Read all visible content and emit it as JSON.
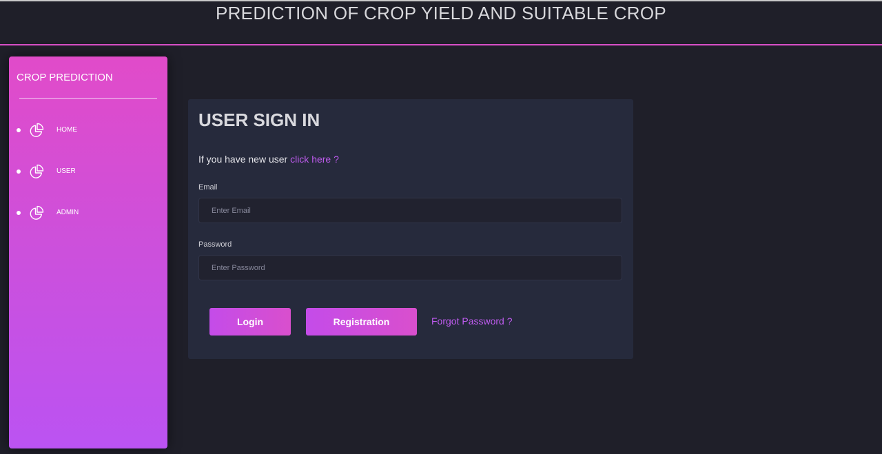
{
  "header": {
    "title": "PREDICTION OF CROP YIELD AND SUITABLE CROP"
  },
  "sidebar": {
    "brand": "CROP PREDICTION",
    "items": [
      {
        "label": "HOME",
        "icon": "pie-chart-icon"
      },
      {
        "label": "USER",
        "icon": "pie-chart-icon"
      },
      {
        "label": "ADMIN",
        "icon": "pie-chart-icon"
      }
    ]
  },
  "signin": {
    "title": "USER SIGN IN",
    "new_user_text": "If you have new user",
    "new_user_link": "click here ?",
    "email_label": "Email",
    "email_placeholder": "Enter Email",
    "password_label": "Password",
    "password_placeholder": "Enter Password",
    "login_label": "Login",
    "registration_label": "Registration",
    "forgot_label": "Forgot Password ?"
  },
  "colors": {
    "background": "#1f1f29",
    "accent": "#d84fc7",
    "sidebar_top": "#e14bc9",
    "sidebar_bottom": "#bb53f2",
    "card": "#262a3c",
    "link": "#c05cf0"
  }
}
